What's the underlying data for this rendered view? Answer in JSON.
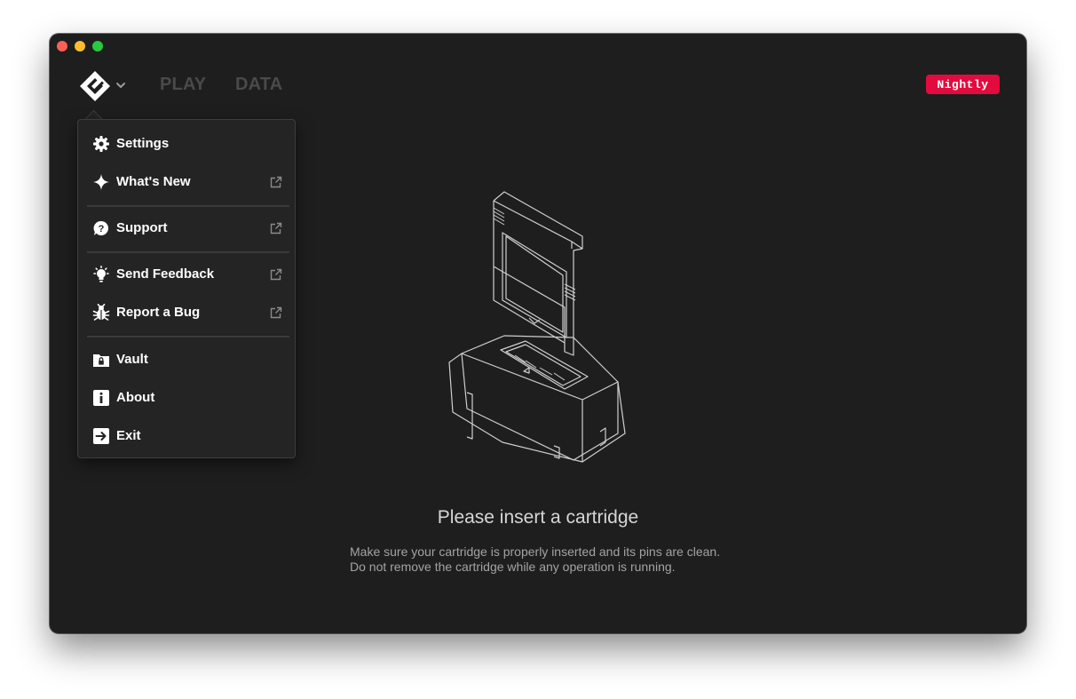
{
  "window": {
    "nav": {
      "tabs": [
        "PLAY",
        "DATA"
      ]
    },
    "badge": "Nightly",
    "menu": {
      "items": [
        {
          "label": "Settings",
          "icon": "gear-icon",
          "external": false
        },
        {
          "label": "What's New",
          "icon": "sparkle-icon",
          "external": true
        },
        {
          "label": "Support",
          "icon": "question-bubble-icon",
          "external": true
        },
        {
          "label": "Send Feedback",
          "icon": "lightbulb-icon",
          "external": true
        },
        {
          "label": "Report a Bug",
          "icon": "bug-icon",
          "external": true
        },
        {
          "label": "Vault",
          "icon": "vault-folder-icon",
          "external": false
        },
        {
          "label": "About",
          "icon": "info-icon",
          "external": false
        },
        {
          "label": "Exit",
          "icon": "exit-icon",
          "external": false
        }
      ]
    },
    "empty_state": {
      "title": "Please insert a cartridge",
      "line1": "Make sure your cartridge is properly inserted and its pins are clean.",
      "line2": "Do not remove the cartridge while any operation is running."
    }
  },
  "colors": {
    "background": "#1e1e1e",
    "badge": "#e30b3d",
    "menu": "#242424",
    "text": "#ffffff"
  }
}
